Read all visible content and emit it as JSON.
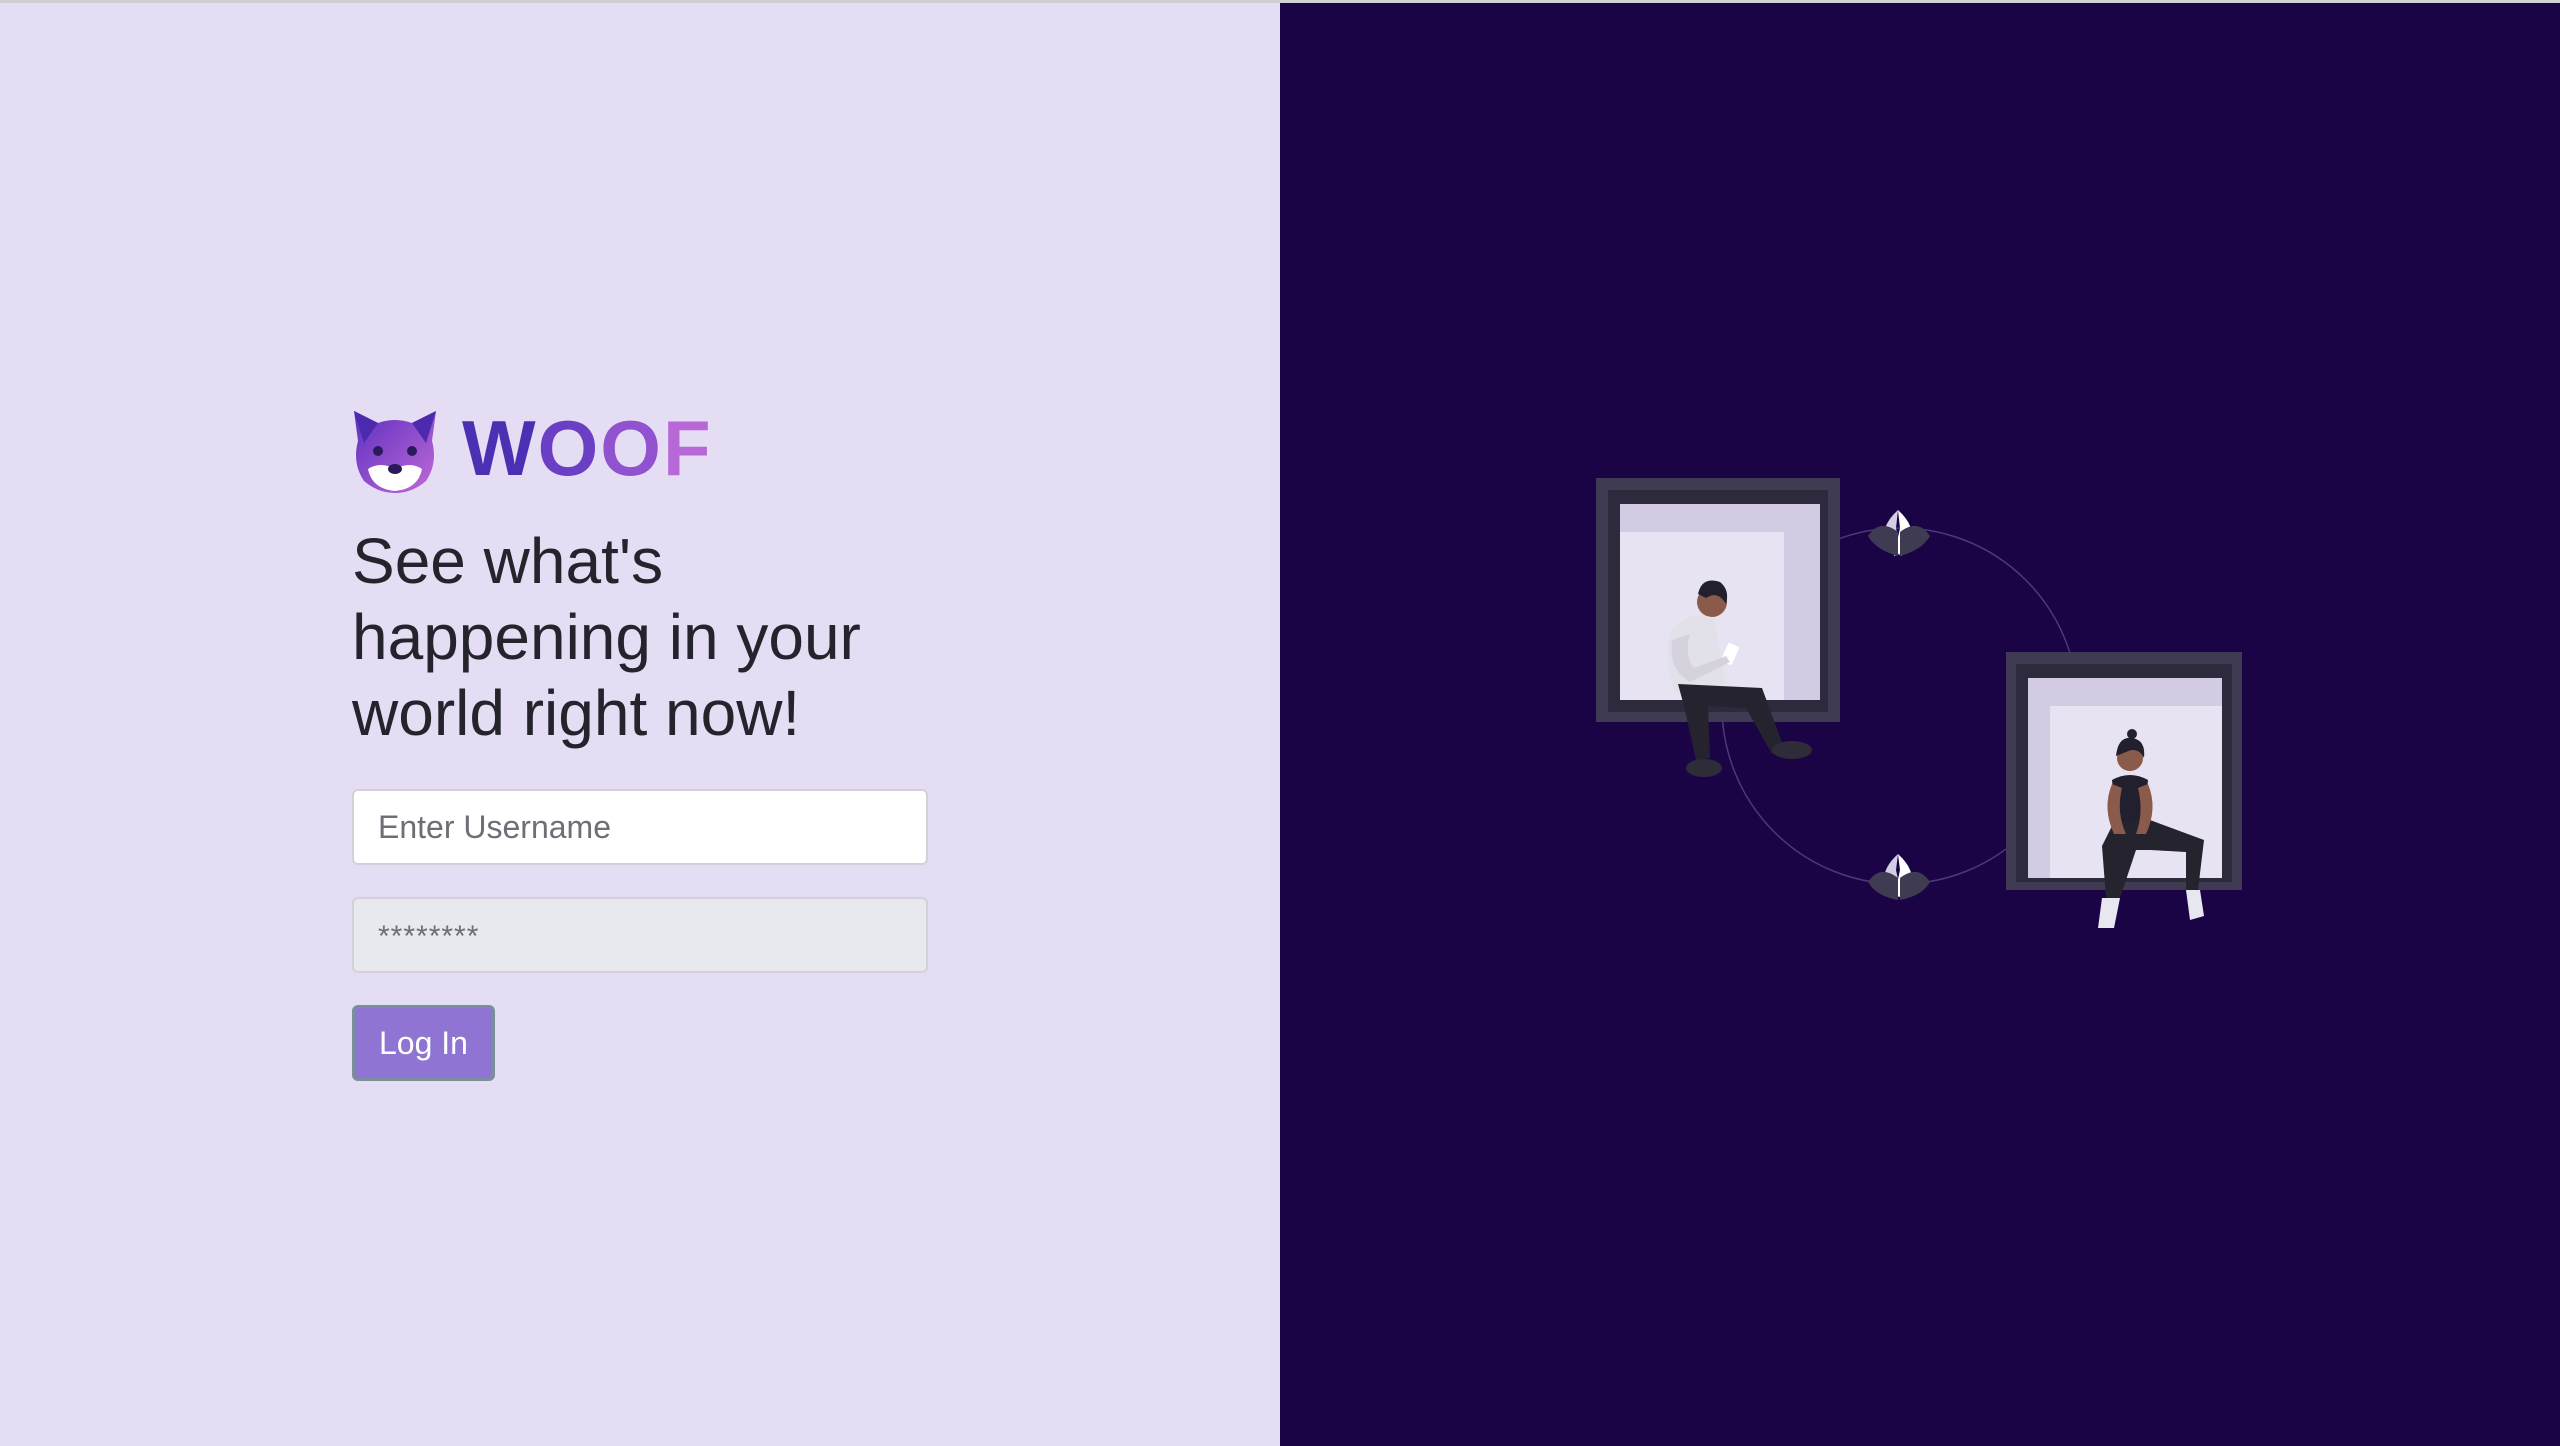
{
  "brand": {
    "name_letters": [
      "W",
      "O",
      "O",
      "F"
    ],
    "logo_icon": "dog-face-icon",
    "gradient": [
      "#4a2db8",
      "#c86fd6"
    ]
  },
  "hero": {
    "headline": "See what's happening in your world right now!"
  },
  "login_form": {
    "username_placeholder": "Enter Username",
    "password_placeholder": "********",
    "submit_label": "Log In"
  },
  "colors": {
    "left_background": "#e4ddf4",
    "right_background": "#1a0445",
    "button": "#8f74d4",
    "headline": "#25232b"
  },
  "illustration": {
    "icon": "people-at-windows-illustration"
  }
}
